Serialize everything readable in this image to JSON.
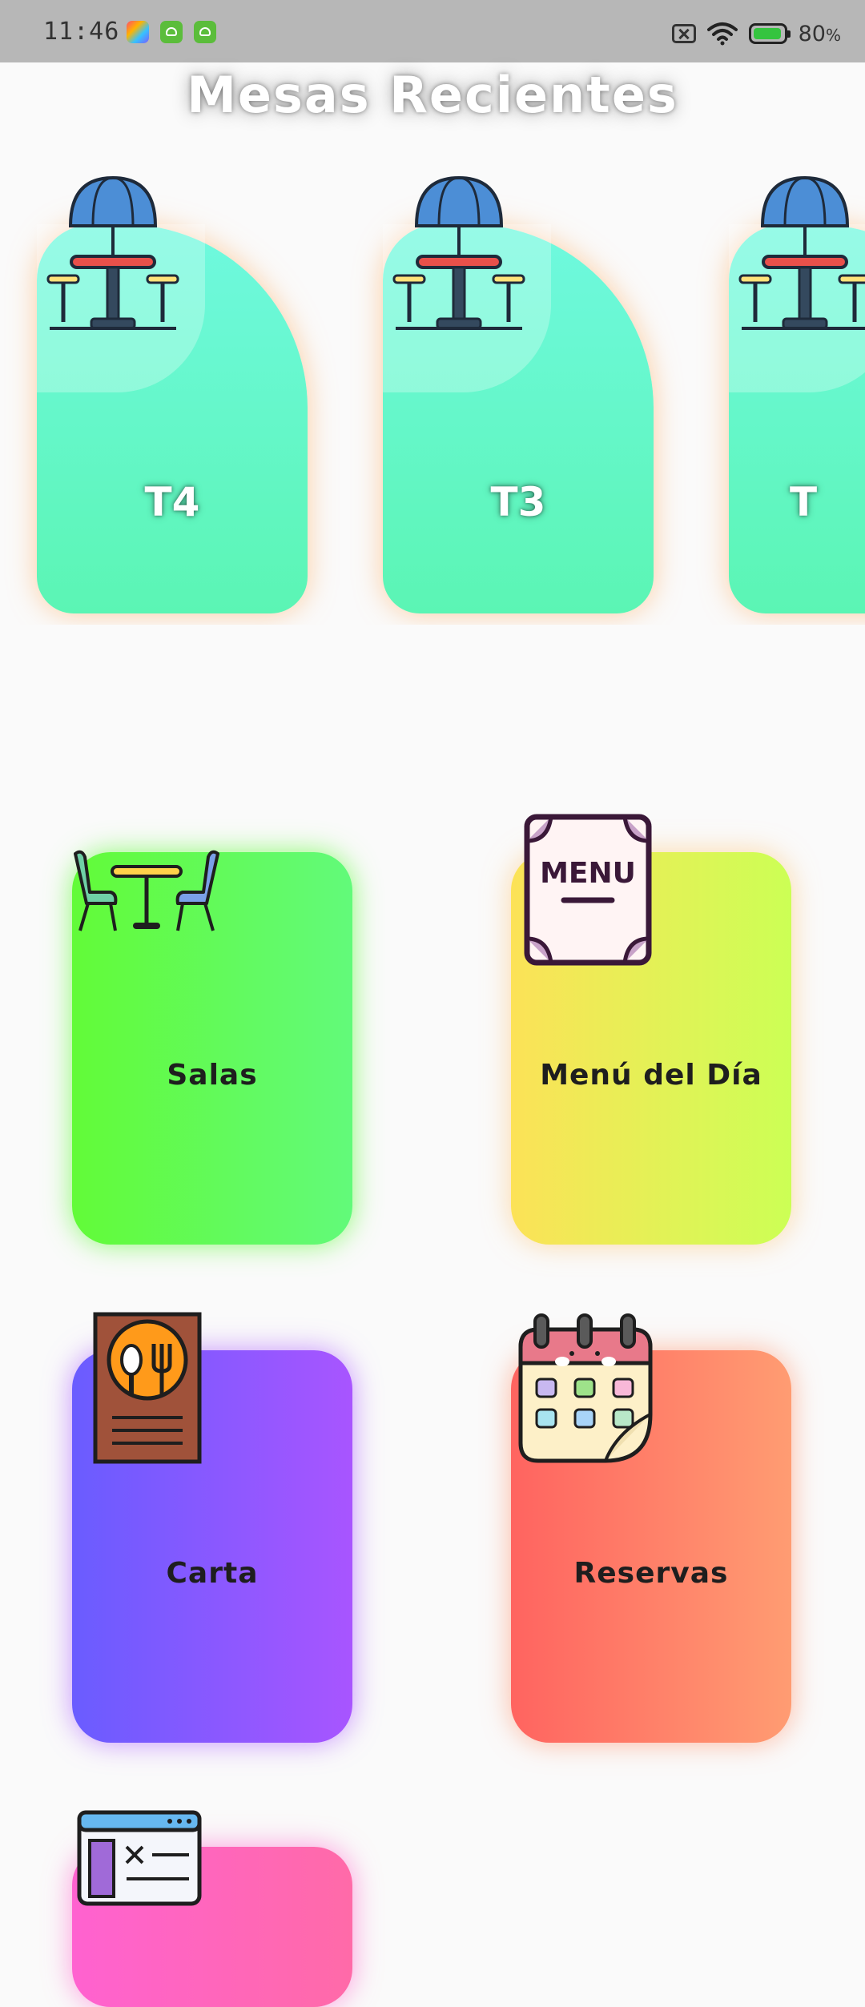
{
  "status_bar": {
    "time": "11:46",
    "battery_percent": "80",
    "battery_unit": "%",
    "battery_level": 0.8
  },
  "page": {
    "title": "Mesas Recientes"
  },
  "recent_tables": [
    {
      "label": "T4",
      "icon": "terrace-table-icon"
    },
    {
      "label": "T3",
      "icon": "terrace-table-icon"
    },
    {
      "label": "T",
      "icon": "terrace-table-icon"
    }
  ],
  "categories": {
    "salas": {
      "label": "Salas",
      "icon": "dining-table-icon",
      "color_start": "#62fb38",
      "color_end": "#62fa7a"
    },
    "menu": {
      "label": "Menú del Día",
      "icon": "menu-board-icon",
      "color_start": "#fce257",
      "color_end": "#ccff55"
    },
    "carta": {
      "label": "Carta",
      "icon": "restaurant-menu-icon",
      "color_start": "#6a5cff",
      "color_end": "#a855ff"
    },
    "reservas": {
      "label": "Reservas",
      "icon": "calendar-icon",
      "color_start": "#ff6460",
      "color_end": "#ff9c72"
    },
    "next": {
      "label": "",
      "icon": "document-icon",
      "color_start": "#ff62d0",
      "color_end": "#ff6aa8"
    }
  }
}
